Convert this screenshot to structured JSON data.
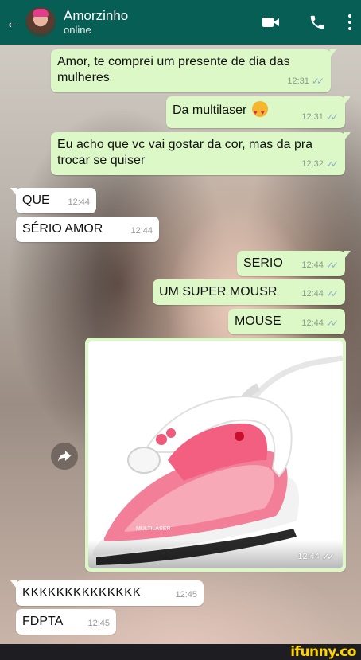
{
  "header": {
    "contact_name": "Amorzinho",
    "status": "online",
    "colors": {
      "header_bg": "#075e54",
      "outgoing_bubble": "#dcf8c6",
      "incoming_bubble": "#ffffff"
    },
    "icons": [
      "back-arrow-icon",
      "avatar",
      "video-call-icon",
      "phone-icon",
      "more-options-icon"
    ]
  },
  "messages": [
    {
      "direction": "out",
      "text": "Amor, te comprei um presente de dia das mulheres",
      "time": "12:31",
      "ticks": "✓✓"
    },
    {
      "direction": "out",
      "text": "Da multilaser",
      "emoji": "smiling-face-with-hearts",
      "time": "12:31",
      "ticks": "✓✓"
    },
    {
      "direction": "out",
      "text": "Eu acho que vc vai gostar da cor, mas da pra trocar se quiser",
      "time": "12:32",
      "ticks": "✓✓"
    },
    {
      "direction": "in",
      "text": "QUE",
      "time": "12:44"
    },
    {
      "direction": "in",
      "text": "SÉRIO AMOR",
      "time": "12:44"
    },
    {
      "direction": "out",
      "text": "SERIO",
      "time": "12:44",
      "ticks": "✓✓"
    },
    {
      "direction": "out",
      "text": "UM SUPER MOUSR",
      "time": "12:44",
      "ticks": "✓✓"
    },
    {
      "direction": "out",
      "text": "MOUSE",
      "time": "12:44",
      "ticks": "✓✓"
    },
    {
      "direction": "out",
      "type": "image",
      "image_subject": "pink-white-steam-iron",
      "image_brand_text": "MULTILASER",
      "time": "12:44",
      "ticks": "✓✓"
    },
    {
      "direction": "in",
      "text": "KKKKKKKKKKKKKK",
      "time": "12:45"
    },
    {
      "direction": "in",
      "text": "FDPTA",
      "time": "12:45"
    }
  ],
  "watermark": {
    "text": "ifunny.co",
    "color": "#ffd400"
  }
}
